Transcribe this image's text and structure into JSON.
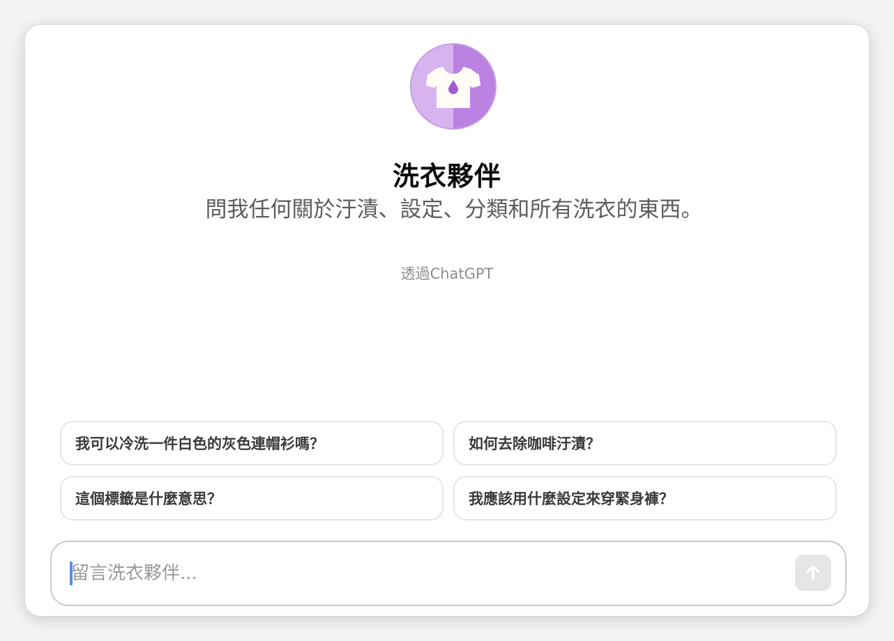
{
  "gpt": {
    "name": "洗衣夥伴",
    "description": "問我任何關於汙漬、設定、分類和所有洗衣的東西。",
    "attribution": "透過ChatGPT",
    "icon": "tshirt-droplet-icon"
  },
  "suggestions": [
    {
      "label": "我可以冷洗一件白色的灰色連帽衫嗎？"
    },
    {
      "label": "如何去除咖啡汙漬？"
    },
    {
      "label": "這個標籤是什麼意思？"
    },
    {
      "label": "我應該用什麼設定來穿緊身褲？"
    }
  ],
  "composer": {
    "placeholder": "留言洗衣夥伴...",
    "value": "",
    "send_icon": "arrow-up-icon"
  },
  "colors": {
    "avatar_left": "#d8b4ef",
    "avatar_right": "#bc82e2",
    "droplet": "#a35cd8",
    "caret": "#5b8de6"
  }
}
